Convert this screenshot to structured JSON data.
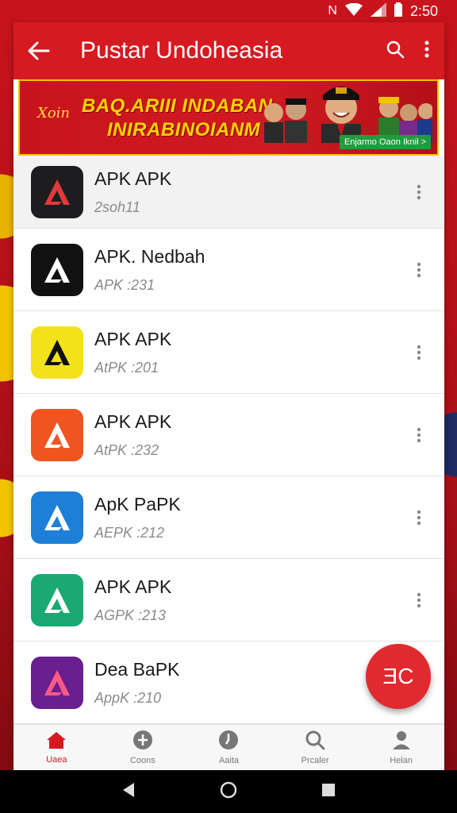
{
  "status_bar": {
    "time": "2:50",
    "nfc": "N",
    "icons": [
      "nfc-icon",
      "wifi-icon",
      "signal-icon",
      "battery-icon"
    ]
  },
  "app_bar": {
    "title": "Pustar Undoheasia",
    "icons": [
      "back-arrow-icon",
      "search-icon",
      "more-vert-icon"
    ]
  },
  "banner": {
    "small_text": "Xoin",
    "line1": "BAQ.ARIII INDABAN",
    "line2": "INIRABINOIANM",
    "cta": "Enjarmo Oaon Iknil >"
  },
  "apps": [
    {
      "name": "APK APK",
      "sub": "2soh11",
      "icon": "apk-red-a-icon",
      "bg": "#1d1d1f",
      "fg": "#e03a3a"
    },
    {
      "name": "APK. Nedbah",
      "sub": "APK :231",
      "icon": "apk-white-a-icon",
      "bg": "#111111",
      "fg": "#ffffff"
    },
    {
      "name": "APK APK",
      "sub": "AtPK :201",
      "icon": "apk-shield-icon",
      "bg": "#f3e21a",
      "fg": "#111111"
    },
    {
      "name": "APK APK",
      "sub": "AtPK :232",
      "icon": "apk-orange-a-icon",
      "bg": "#f0541f",
      "fg": "#ffffff"
    },
    {
      "name": "ApK PaPK",
      "sub": "AEPK :212",
      "icon": "apk-rainbow-icon",
      "bg": "#1e7fd8",
      "fg": "#ffffff"
    },
    {
      "name": "APK APK",
      "sub": "AGPK :213",
      "icon": "apk-green-icon",
      "bg": "#1aa873",
      "fg": "#ffffff"
    },
    {
      "name": "Dea BaPK",
      "sub": "AppK :210",
      "icon": "apk-purple-icon",
      "bg": "#6a1f8f",
      "fg": "#ff5a86"
    }
  ],
  "fab": {
    "label": "ƎC"
  },
  "bottom_nav": [
    {
      "label": "Uaea",
      "icon": "home-icon",
      "active": true
    },
    {
      "label": "Coons",
      "icon": "info-circle-icon",
      "active": false
    },
    {
      "label": "Aaita",
      "icon": "clock-icon",
      "active": false
    },
    {
      "label": "Prcaler",
      "icon": "search-icon",
      "active": false
    },
    {
      "label": "Helan",
      "icon": "person-icon",
      "active": false
    }
  ],
  "system_nav": [
    "back-triangle-icon",
    "home-circle-icon",
    "recents-square-icon"
  ],
  "colors": {
    "primary": "#d51a22",
    "banner_text": "#ffd400",
    "fab": "#e12a2f"
  }
}
